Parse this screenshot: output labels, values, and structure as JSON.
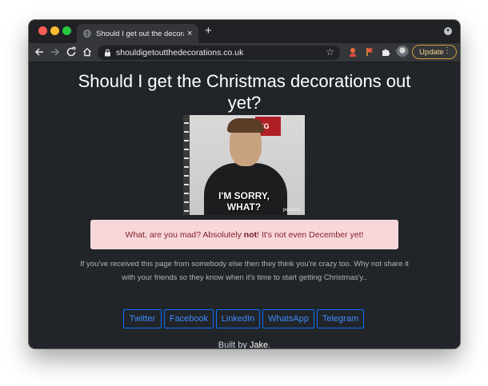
{
  "browser": {
    "tab_title": "Should I get out the decoratio",
    "tab_close": "×",
    "new_tab": "+",
    "url": "shouldigetoutthedecorations.co.uk",
    "update_label": "Update",
    "update_menu": "⋮",
    "star": "☆"
  },
  "page": {
    "title": "Should I get the Christmas decorations out yet?",
    "gif_caption_line1": "I'M SORRY,",
    "gif_caption_line2": "WHAT?",
    "gif_watermark": "peacock",
    "gif_sign_text": "NG",
    "alert_prefix": "What, are you mad? Absolutely ",
    "alert_bold": "not",
    "alert_suffix": "! It's not even December yet!",
    "description": "If you've received this page from somebody else then they think you're crazy too. Why not share it with your friends so they know when it's time to start getting Christmas'y..",
    "share_buttons": [
      "Twitter",
      "Facebook",
      "LinkedIn",
      "WhatsApp",
      "Telegram"
    ],
    "built_prefix": "Built by ",
    "built_link": "Jake",
    "built_suffix": "."
  },
  "colors": {
    "page_bg": "#212529",
    "alert_bg": "#f8d7da",
    "alert_text": "#842029",
    "share_border": "#0d6efd",
    "update_accent": "#c9a23a"
  }
}
